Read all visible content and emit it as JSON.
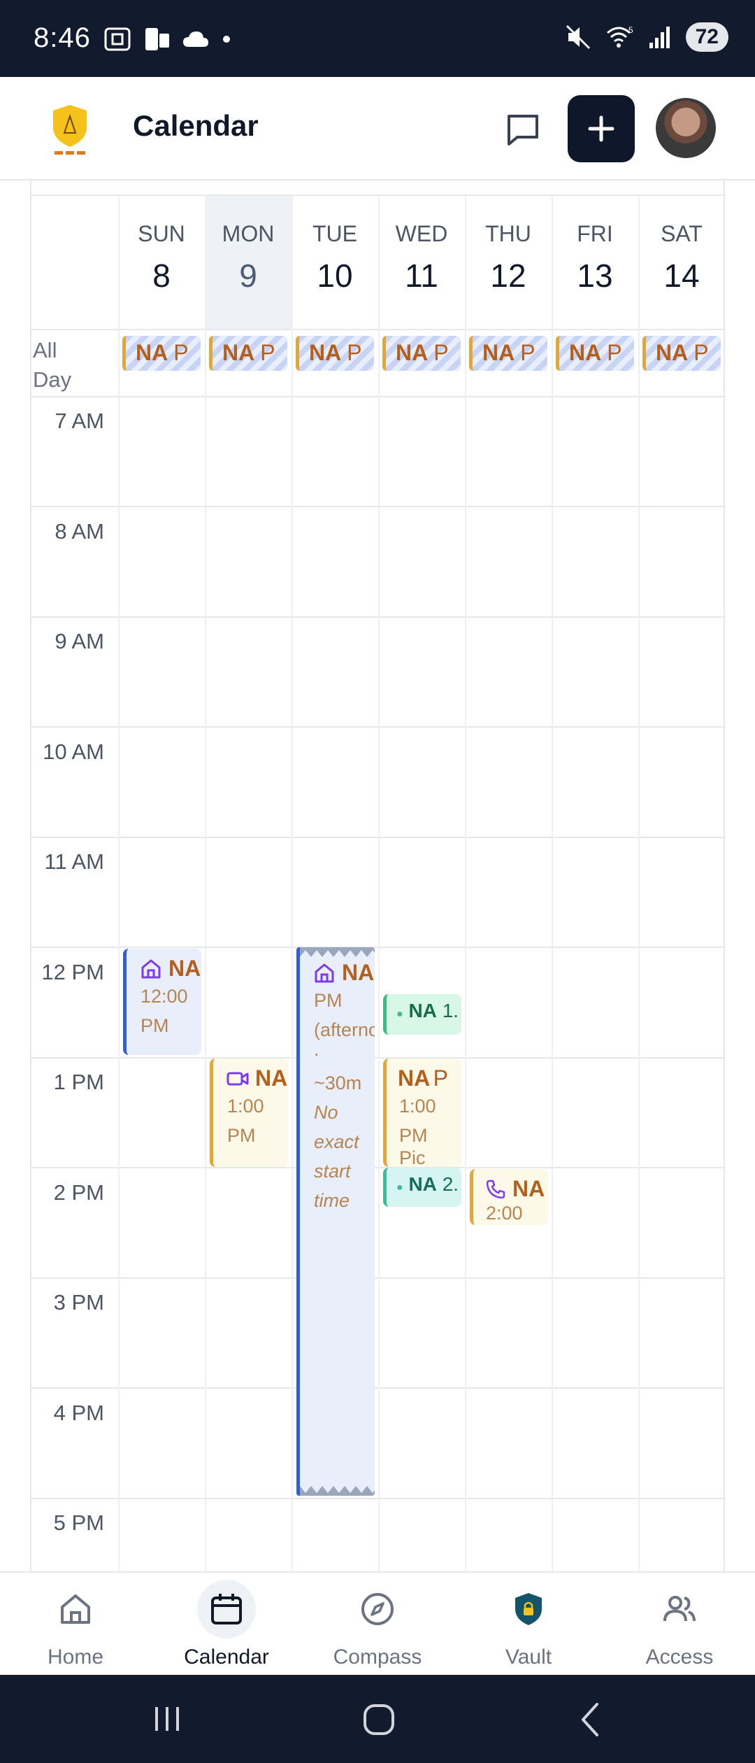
{
  "status_bar": {
    "time": "8:46",
    "battery": "72"
  },
  "header": {
    "title": "Calendar"
  },
  "days": [
    {
      "name": "SUN",
      "num": "8"
    },
    {
      "name": "MON",
      "num": "9"
    },
    {
      "name": "TUE",
      "num": "10"
    },
    {
      "name": "WED",
      "num": "11"
    },
    {
      "name": "THU",
      "num": "12"
    },
    {
      "name": "FRI",
      "num": "13"
    },
    {
      "name": "SAT",
      "num": "14"
    }
  ],
  "all_day": {
    "label_1": "All",
    "label_2": "Day",
    "chip_title": "NA",
    "chip_suffix": "P"
  },
  "hours": [
    "7 AM",
    "8 AM",
    "9 AM",
    "10 AM",
    "11 AM",
    "12 PM",
    "1 PM",
    "2 PM",
    "3 PM",
    "4 PM",
    "5 PM"
  ],
  "events": {
    "sun": {
      "title": "NA",
      "time": "12:00",
      "ampm": "PM",
      "icon": "house-icon"
    },
    "mon": {
      "title": "NA",
      "time": "1:00",
      "ampm": "PM",
      "icon": "video-icon"
    },
    "tue": {
      "title": "NA",
      "line1": "PM",
      "line2": "(afternoon)",
      "line3": ".",
      "duration": "~30m",
      "note1": "No",
      "note2": "exact",
      "note3": "start",
      "note4": "time",
      "icon": "house-icon"
    },
    "wed_a": {
      "title": "NA",
      "suffix": "1."
    },
    "wed_b": {
      "title": "NA",
      "suffix": "P",
      "time": "1:00",
      "ampm": "PM",
      "more": "Pic"
    },
    "wed_c": {
      "title": "NA",
      "suffix": "2."
    },
    "thu": {
      "title": "NA",
      "time": "2:00",
      "icon": "phone-icon"
    }
  },
  "nav": [
    {
      "label": "Home",
      "icon": "home-icon"
    },
    {
      "label": "Calendar",
      "icon": "calendar-icon"
    },
    {
      "label": "Compass",
      "icon": "compass-icon"
    },
    {
      "label": "Vault",
      "icon": "vault-shield-icon"
    },
    {
      "label": "Access",
      "icon": "users-icon"
    }
  ],
  "colors": {
    "status_bg": "#121a2e",
    "accent_event_blue": "#2f5fd0",
    "accent_event_amber": "#e2a63b",
    "accent_event_green": "#3dbb82"
  }
}
